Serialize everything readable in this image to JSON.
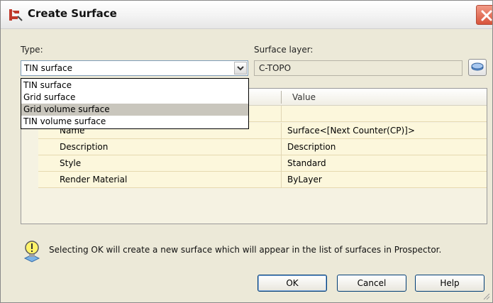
{
  "dialog": {
    "title": "Create Surface",
    "colors": {
      "title_accent": "#d8543b",
      "selection": "#c9c6bd",
      "grid_bg": "#fcf7dc"
    }
  },
  "type": {
    "label": "Type:",
    "selected": "TIN surface",
    "options": [
      "TIN surface",
      "Grid surface",
      "Grid volume surface",
      "TIN volume surface"
    ],
    "highlighted_option": "Grid volume surface"
  },
  "surface_layer": {
    "label": "Surface layer:",
    "value": "C-TOPO",
    "button_icon": "layer-picker-icon"
  },
  "properties": {
    "column_value_header": "Value",
    "rows": [
      {
        "property": "Name",
        "value": "Surface<[Next Counter(CP)]>"
      },
      {
        "property": "Description",
        "value": "Description"
      },
      {
        "property": "Style",
        "value": "Standard"
      },
      {
        "property": "Render Material",
        "value": "ByLayer"
      }
    ]
  },
  "info": {
    "icon": "lightbulb-icon",
    "text": "Selecting OK will create a new surface which will appear in the list of surfaces in Prospector."
  },
  "buttons": {
    "ok": "OK",
    "cancel": "Cancel",
    "help": "Help"
  }
}
